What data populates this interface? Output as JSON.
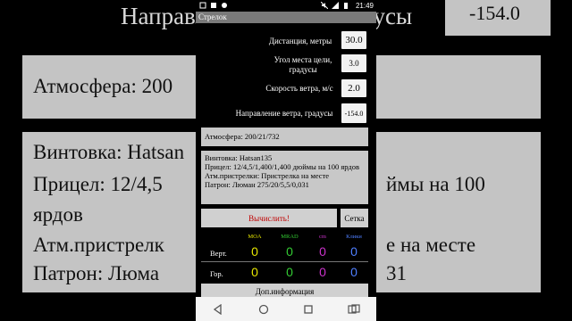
{
  "background": {
    "heading": "Направление ветра, градусы",
    "wind_dir_value": "-154.0",
    "atmosphere": "Атмосфера: 200",
    "rifle_lines": [
      "Винтовка: Hatsan",
      "Прицел: 12/4,5",
      "ярдов",
      "Атм.пристрелк",
      "Патрон: Люма"
    ],
    "rifle_right": [
      "ймы на 100",
      "е на месте",
      "31"
    ]
  },
  "statusbar": {
    "time": "21:49"
  },
  "app": {
    "title": "Стрелок"
  },
  "inputs": {
    "distance_label": "Дистанция, метры",
    "distance_value": "30.0",
    "angle_label": "Угол места цели, градусы",
    "angle_value": "3.0",
    "wind_speed_label": "Скорость ветра, м/с",
    "wind_speed_value": "2.0",
    "wind_dir_label": "Направление ветра, градусы",
    "wind_dir_value": "-154.0"
  },
  "atmosphere": {
    "text": "Атмосфера: 200/21/732"
  },
  "rifle": {
    "lines": [
      "Винтовка: Hatsan135",
      "Прицел: 12/4,5/1,400/1,400 дюймы на 100 ярдов",
      "Атм.пристрелки: Пристрелка на месте",
      "Патрон: Люман 275/20/5,5/0,031"
    ]
  },
  "buttons": {
    "calculate": "Вычислить!",
    "grid": "Сетка",
    "more_info": "Доп.информация"
  },
  "results": {
    "headers": [
      "MOA",
      "MRAD",
      "cm",
      "Клики"
    ],
    "header_colors": [
      "#e6e600",
      "#33cc33",
      "#cc33cc",
      "#4f7fff"
    ],
    "vertical_label": "Верт.",
    "horizontal_label": "Гор.",
    "vertical": [
      "0",
      "0",
      "0",
      "0"
    ],
    "horizontal": [
      "0",
      "0",
      "0",
      "0"
    ]
  }
}
